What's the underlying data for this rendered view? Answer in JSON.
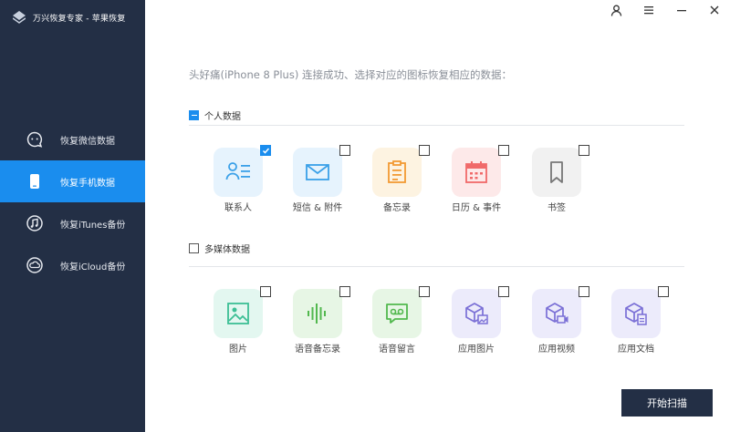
{
  "app": {
    "title": "万兴恢复专家 - 苹果恢复"
  },
  "sidebar": {
    "items": [
      {
        "label": "恢复微信数据",
        "icon": "wechat-icon",
        "active": false
      },
      {
        "label": "恢复手机数据",
        "icon": "phone-icon",
        "active": true
      },
      {
        "label": "恢复iTunes备份",
        "icon": "itunes-icon",
        "active": false
      },
      {
        "label": "恢复iCloud备份",
        "icon": "icloud-icon",
        "active": false
      }
    ]
  },
  "window_controls": [
    "user-icon",
    "menu-icon",
    "minimize-icon",
    "close-icon"
  ],
  "main": {
    "prompt": "头好痛(iPhone 8 Plus) 连接成功、选择对应的图标恢复相应的数据：",
    "personal": {
      "label": "个人数据",
      "state": "partial",
      "items": [
        {
          "label": "联系人",
          "icon": "contacts-icon",
          "checked": true,
          "color": "#3aa0e8",
          "bg": "#e6f3fd"
        },
        {
          "label": "短信 & 附件",
          "icon": "message-icon",
          "checked": false,
          "color": "#3aa0e8",
          "bg": "#e6f3fd"
        },
        {
          "label": "备忘录",
          "icon": "notes-icon",
          "checked": false,
          "color": "#f29a34",
          "bg": "#fdf3e1"
        },
        {
          "label": "日历 & 事件",
          "icon": "calendar-icon",
          "checked": false,
          "color": "#f06a6a",
          "bg": "#fde9e9"
        },
        {
          "label": "书签",
          "icon": "bookmark-icon",
          "checked": false,
          "color": "#777777",
          "bg": "#f1f1f1"
        }
      ]
    },
    "media": {
      "label": "多媒体数据",
      "state": "unchecked",
      "items": [
        {
          "label": "图片",
          "icon": "photo-icon",
          "checked": false,
          "color": "#3cbf95",
          "bg": "#e3f7f0"
        },
        {
          "label": "语音备忘录",
          "icon": "voice-memo-icon",
          "checked": false,
          "color": "#52b84e",
          "bg": "#e7f6e5"
        },
        {
          "label": "语音留言",
          "icon": "voicemail-icon",
          "checked": false,
          "color": "#52b84e",
          "bg": "#e7f6e5"
        },
        {
          "label": "应用图片",
          "icon": "app-photo-icon",
          "checked": false,
          "color": "#7a6fd6",
          "bg": "#ecebfb"
        },
        {
          "label": "应用视频",
          "icon": "app-video-icon",
          "checked": false,
          "color": "#7a6fd6",
          "bg": "#ecebfb"
        },
        {
          "label": "应用文档",
          "icon": "app-document-icon",
          "checked": false,
          "color": "#7a6fd6",
          "bg": "#ecebfb"
        }
      ]
    },
    "scan_button": "开始扫描"
  },
  "colors": {
    "sidebar_bg": "#232f45",
    "accent": "#1a8dee"
  }
}
